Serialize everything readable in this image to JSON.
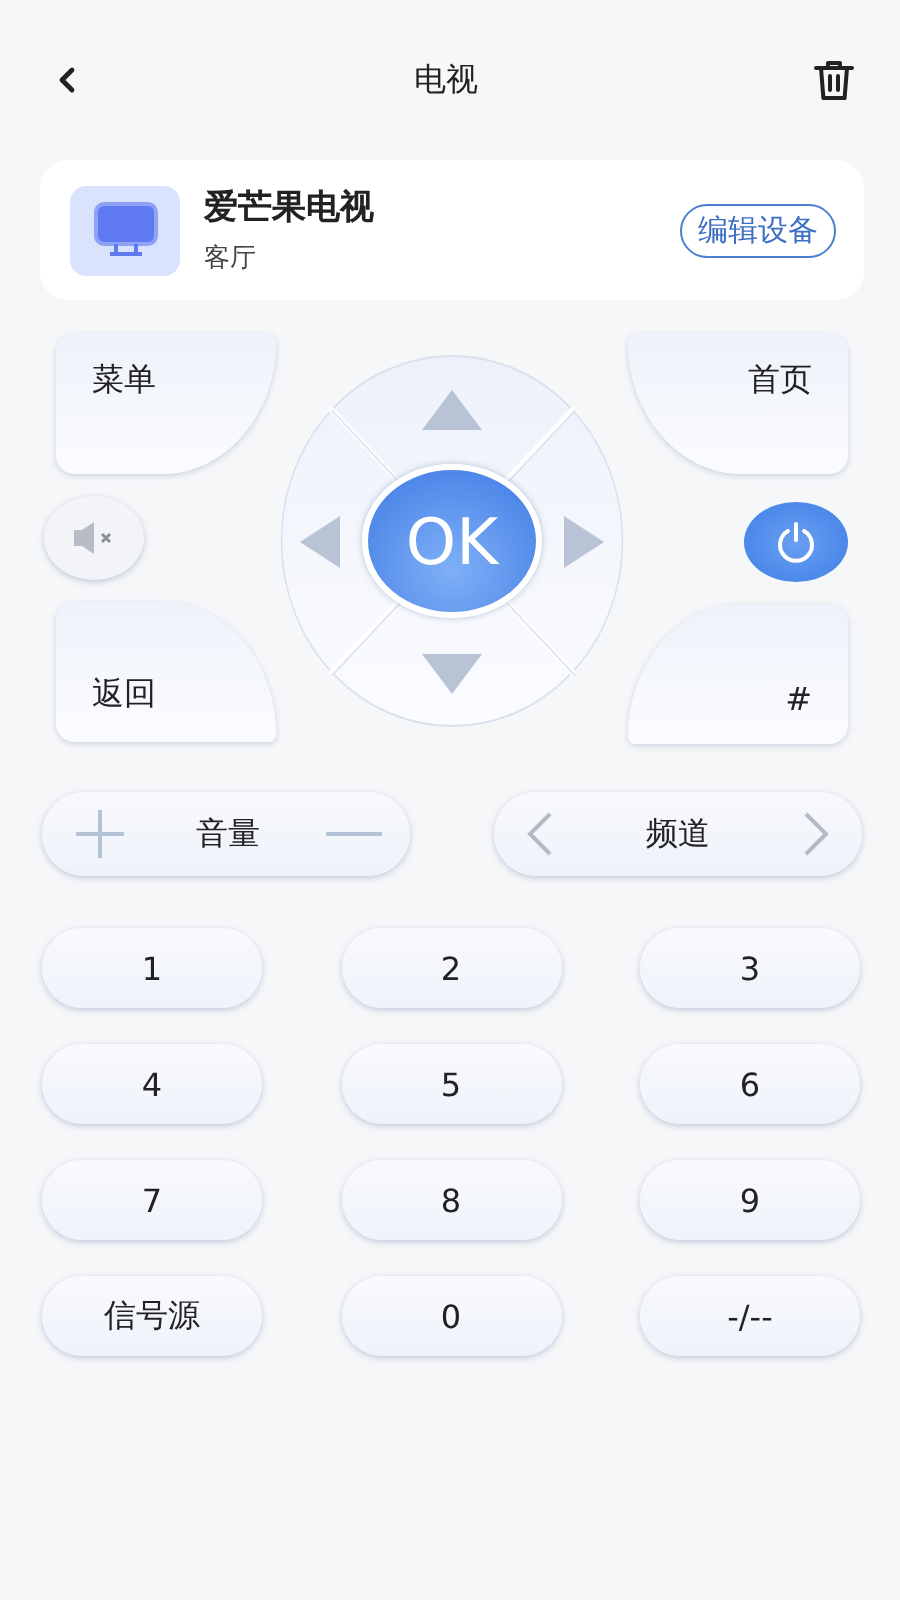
{
  "header": {
    "title": "电视"
  },
  "device": {
    "name": "爱芒果电视",
    "room": "客厅",
    "edit_button": "编辑设备"
  },
  "remote": {
    "corner_buttons": [
      {
        "label": "菜单"
      },
      {
        "label": "首页"
      },
      {
        "label": "返回"
      },
      {
        "label": "#"
      }
    ],
    "ok": "OK"
  },
  "volume": {
    "label": "音量"
  },
  "channel": {
    "label": "频道"
  },
  "keypad": [
    "1",
    "2",
    "3",
    "4",
    "5",
    "6",
    "7",
    "8",
    "9",
    "信号源",
    "0",
    "-/--"
  ]
}
